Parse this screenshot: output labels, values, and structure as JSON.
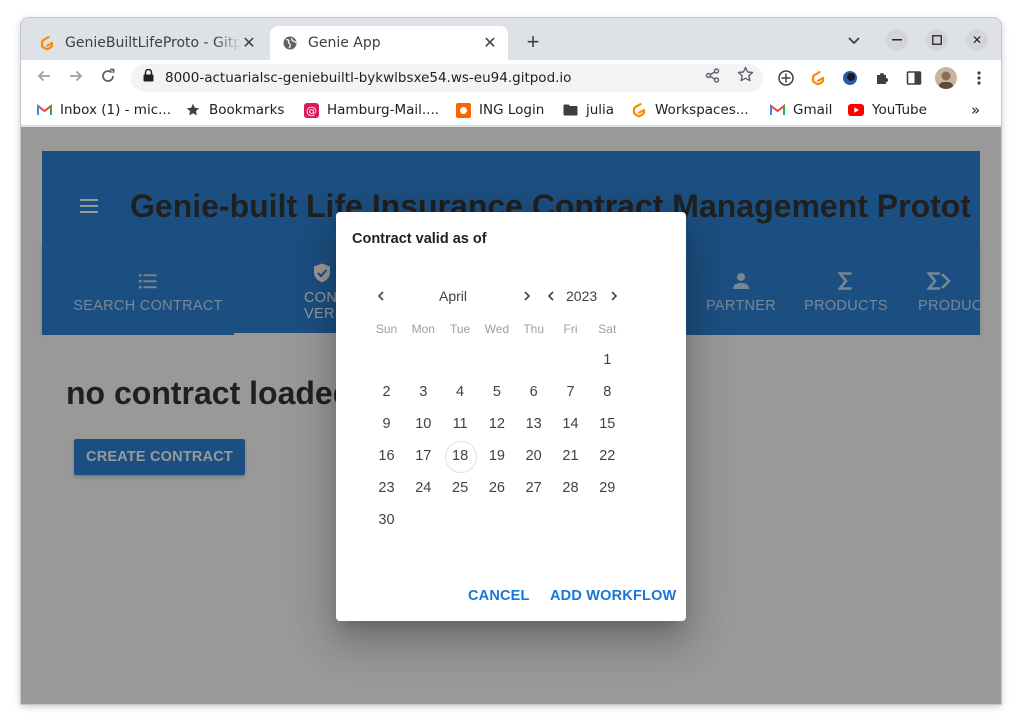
{
  "browser": {
    "tabs": [
      {
        "title": "GenieBuiltLifeProto - Gitp",
        "icon": "gitpod-icon",
        "active": false
      },
      {
        "title": "Genie App",
        "icon": "globe-icon",
        "active": true
      }
    ],
    "url": "8000-actuarialsc-geniebuiltl-bykwlbsxe54.ws-eu94.gitpod.io",
    "bookmarks": [
      {
        "label": "Inbox (1) - mic...",
        "icon": "gmail-icon"
      },
      {
        "label": "Bookmarks",
        "icon": "star-icon"
      },
      {
        "label": "Hamburg-Mail....",
        "icon": "at-icon"
      },
      {
        "label": "ING Login",
        "icon": "ing-icon"
      },
      {
        "label": "julia",
        "icon": "folder-icon"
      },
      {
        "label": "Workspaces...",
        "icon": "gitpod-icon"
      },
      {
        "label": "Gmail",
        "icon": "gmail-icon"
      },
      {
        "label": "YouTube",
        "icon": "youtube-icon"
      }
    ]
  },
  "app": {
    "title": "Genie-built Life Insurance Contract Management Prototype",
    "nav_tabs": [
      {
        "label": "SEARCH CONTRACT",
        "icon": "list-icon",
        "active": false
      },
      {
        "label": "CONTRACT VERSION",
        "icon": "shield-check-icon",
        "active": true
      },
      {
        "label": "PARTNER",
        "icon": "person-icon",
        "active": false
      },
      {
        "label": "PRODUCTS",
        "icon": "sigma-icon",
        "active": false
      },
      {
        "label": "PRODUCT",
        "icon": "sigma-arrow-icon",
        "active": false
      }
    ],
    "heading": "no contract loaded",
    "create_button": "CREATE CONTRACT"
  },
  "dialog": {
    "title": "Contract valid as of",
    "month": "April",
    "year": "2023",
    "weekdays": [
      "Sun",
      "Mon",
      "Tue",
      "Wed",
      "Thu",
      "Fri",
      "Sat"
    ],
    "days": [
      "1",
      "2",
      "3",
      "4",
      "5",
      "6",
      "7",
      "8",
      "9",
      "10",
      "11",
      "12",
      "13",
      "14",
      "15",
      "16",
      "17",
      "18",
      "19",
      "20",
      "21",
      "22",
      "23",
      "24",
      "25",
      "26",
      "27",
      "28",
      "29",
      "30"
    ],
    "today": "18",
    "cancel_label": "CANCEL",
    "confirm_label": "ADD WORKFLOW"
  },
  "colors": {
    "primary": "#1976d2",
    "overlay": "rgba(33,33,33,.46)"
  }
}
